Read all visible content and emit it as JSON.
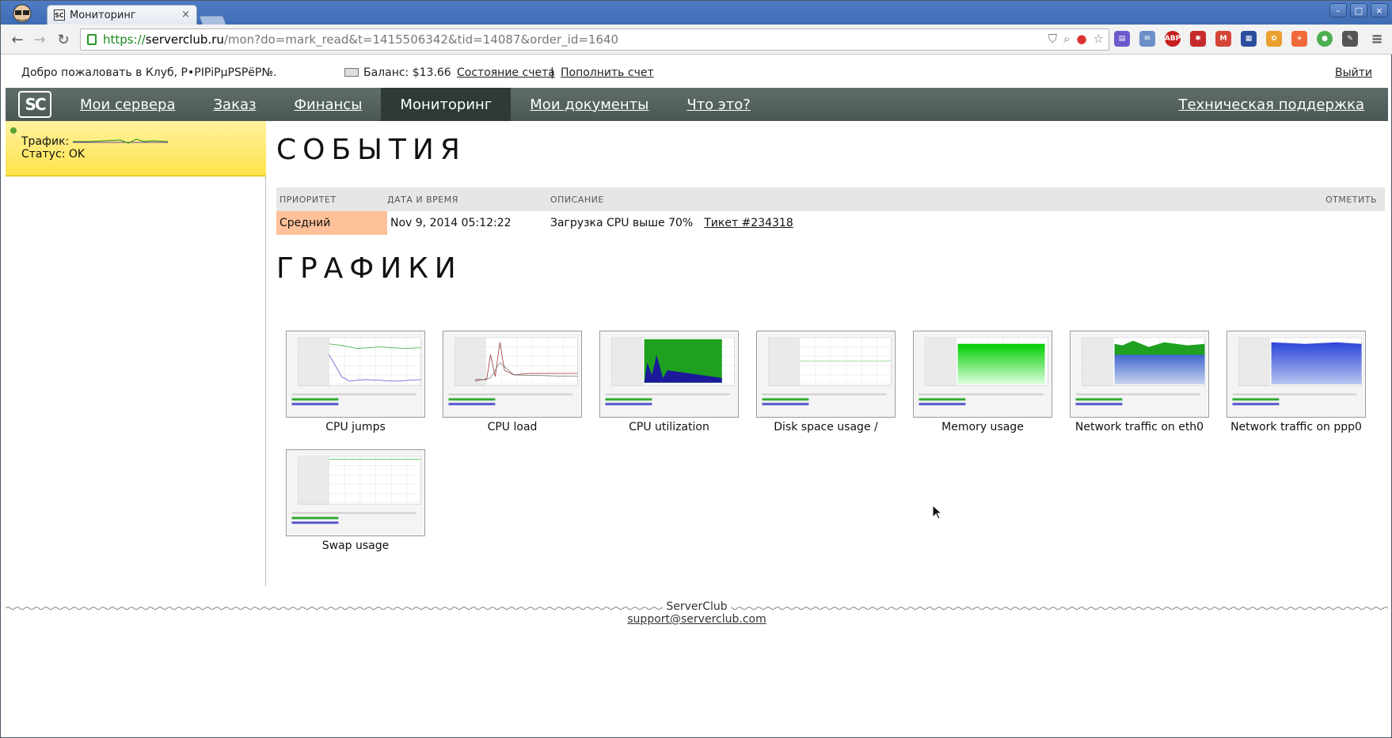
{
  "browser": {
    "tab_title": "Мониторинг",
    "tab_close": "×",
    "url": {
      "scheme": "https://",
      "host": "serverclub.ru",
      "path": "/mon?do=mark_read&t=1415506342&tid=14087&order_id=1640"
    }
  },
  "topbar": {
    "welcome": "Добро пожаловать в Клуб, Р•РІРіРµРЅРёР№.",
    "balance_label": "Баланс: $13.66",
    "account_state": "Состояние счета",
    "separator": "|",
    "top_up": "Пополнить счет",
    "logout": "Выйти"
  },
  "nav": {
    "logo": "SC",
    "items": [
      "Мои сервера",
      "Заказ",
      "Финансы",
      "Мониторинг",
      "Мои документы",
      "Что это?"
    ],
    "active_index": 3,
    "support": "Техническая поддержка"
  },
  "sidebar": {
    "traffic_label": "Трафик:",
    "status_label": "Статус: OK",
    "status_color": "#5ca334"
  },
  "events": {
    "title": "СОБЫТИЯ",
    "headers": [
      "ПРИОРИТЕТ",
      "ДАТА И ВРЕМЯ",
      "ОПИСАНИЕ",
      "ОТМЕТИТЬ"
    ],
    "rows": [
      {
        "priority": "Средний",
        "datetime": "Nov 9, 2014 05:12:22",
        "description": "Загрузка CPU выше 70%",
        "ticket": "Тикет #234318",
        "priority_color": "#ffc199"
      }
    ]
  },
  "graphs": {
    "title": "ГРАФИКИ",
    "items": [
      {
        "caption": "CPU jumps",
        "kind": "lines"
      },
      {
        "caption": "CPU load",
        "kind": "load"
      },
      {
        "caption": "CPU utilization",
        "kind": "fill-green"
      },
      {
        "caption": "Disk space usage /",
        "kind": "flat"
      },
      {
        "caption": "Memory usage",
        "kind": "fill-green-fade"
      },
      {
        "caption": "Network traffic on eth0",
        "kind": "net-green-blue"
      },
      {
        "caption": "Network traffic on ppp0",
        "kind": "net-blue"
      },
      {
        "caption": "Swap usage",
        "kind": "flat-green"
      }
    ]
  },
  "footer": {
    "brand": "ServerClub",
    "email": "support@serverclub.com"
  }
}
